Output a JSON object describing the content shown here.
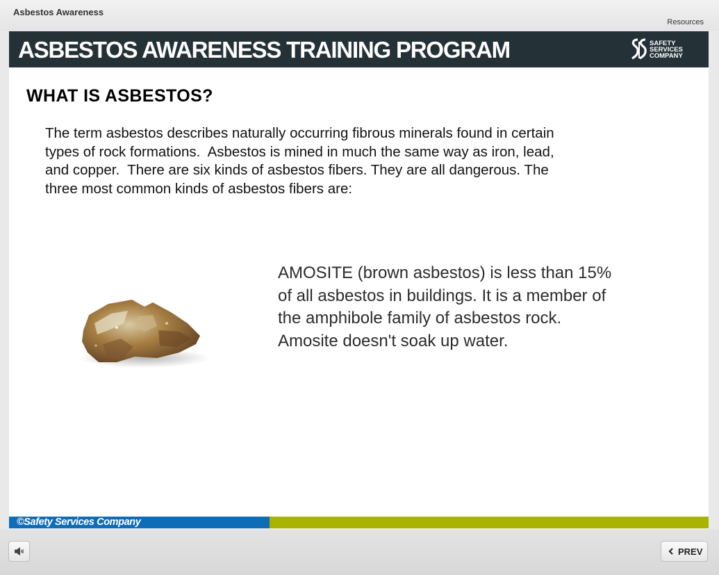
{
  "window": {
    "course_title": "Asbestos Awareness",
    "resources_label": "Resources"
  },
  "banner": {
    "title": "ASBESTOS AWARENESS TRAINING PROGRAM",
    "logo_line1": "SAFETY",
    "logo_line2": "SERVICES",
    "logo_line3": "COMPANY"
  },
  "slide": {
    "heading": "WHAT IS ASBESTOS?",
    "intro": "The term asbestos describes naturally occurring fibrous minerals found in certain\ntypes of rock formations.  Asbestos is mined in much the same way as iron, lead,\nand copper.  There are six kinds of asbestos fibers. They are all dangerous. The\nthree most common kinds of asbestos fibers are:",
    "description": "AMOSITE (brown asbestos) is less than 15%\nof all asbestos in buildings. It is a member of\nthe amphibole family of asbestos rock.\nAmosite doesn't soak up water.",
    "copyright": "©Safety Services Company"
  },
  "controls": {
    "prev_label": "PREV",
    "audio_icon": "speaker-icon",
    "prev_icon": "chevron-left-icon"
  },
  "colors": {
    "banner_bg": "#243238",
    "footer_blue": "#0f6cb6",
    "footer_green": "#aab400"
  }
}
